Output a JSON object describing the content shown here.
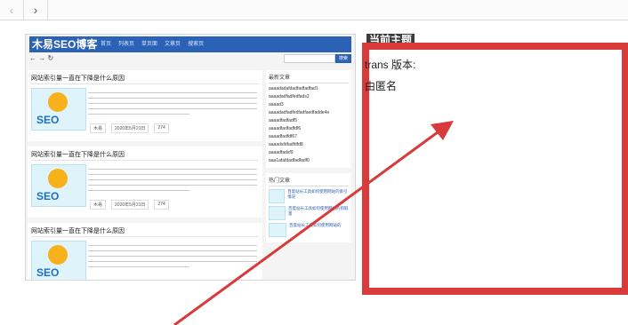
{
  "browser": {
    "back_icon": "chevron-left-icon",
    "forward_icon": "chevron-right-icon",
    "back_glyph": "‹",
    "forward_glyph": "›"
  },
  "preview": {
    "logo": "木易SEO博客",
    "menu": [
      "首页",
      "列表页",
      "单页面",
      "文章页",
      "搜索页"
    ],
    "toolbar_glyphs": "← → ↻",
    "search_button": "搜索",
    "posts": [
      {
        "title": "网站索引量一直在下降是什么原因",
        "thumb_text": "SEO",
        "meta": [
          "木易",
          "2020年5月21日",
          "274"
        ]
      },
      {
        "title": "网站索引量一直在下降是什么原因",
        "thumb_text": "SEO",
        "meta": [
          "木易",
          "2020年5月21日",
          "274"
        ]
      },
      {
        "title": "网站索引量一直在下降是什么原因",
        "thumb_text": "SEO",
        "meta": []
      }
    ],
    "sidebar": {
      "latest_title": "最新文章",
      "latest_items": [
        "aaaadadafdadfadfadfad1",
        "aaaadadfadfedfads2",
        "aaaad3",
        "aaaadadfadfedfadfaedfadde4e",
        "aaaadfadfadf5",
        "aaaadfadfadfdf6",
        "aaaadfadfdf67",
        "aaaadsfdfadfdfd8",
        "aaaadfadsf9",
        "aaa1afafdadfadfadf0"
      ],
      "hot_title": "热门文章",
      "hot_items": [
        "百度站长工具如何使用网站的索引情况",
        "百度站长工具如何使用网站的抓取量",
        "百度站长工具如何使用网站的"
      ]
    }
  },
  "details": {
    "theme_label": "当前主题",
    "version_line": "trans 版本:",
    "author_line": "由匿名"
  },
  "colors": {
    "highlight": "#d93a3a",
    "site_header": "#2b62b5"
  }
}
